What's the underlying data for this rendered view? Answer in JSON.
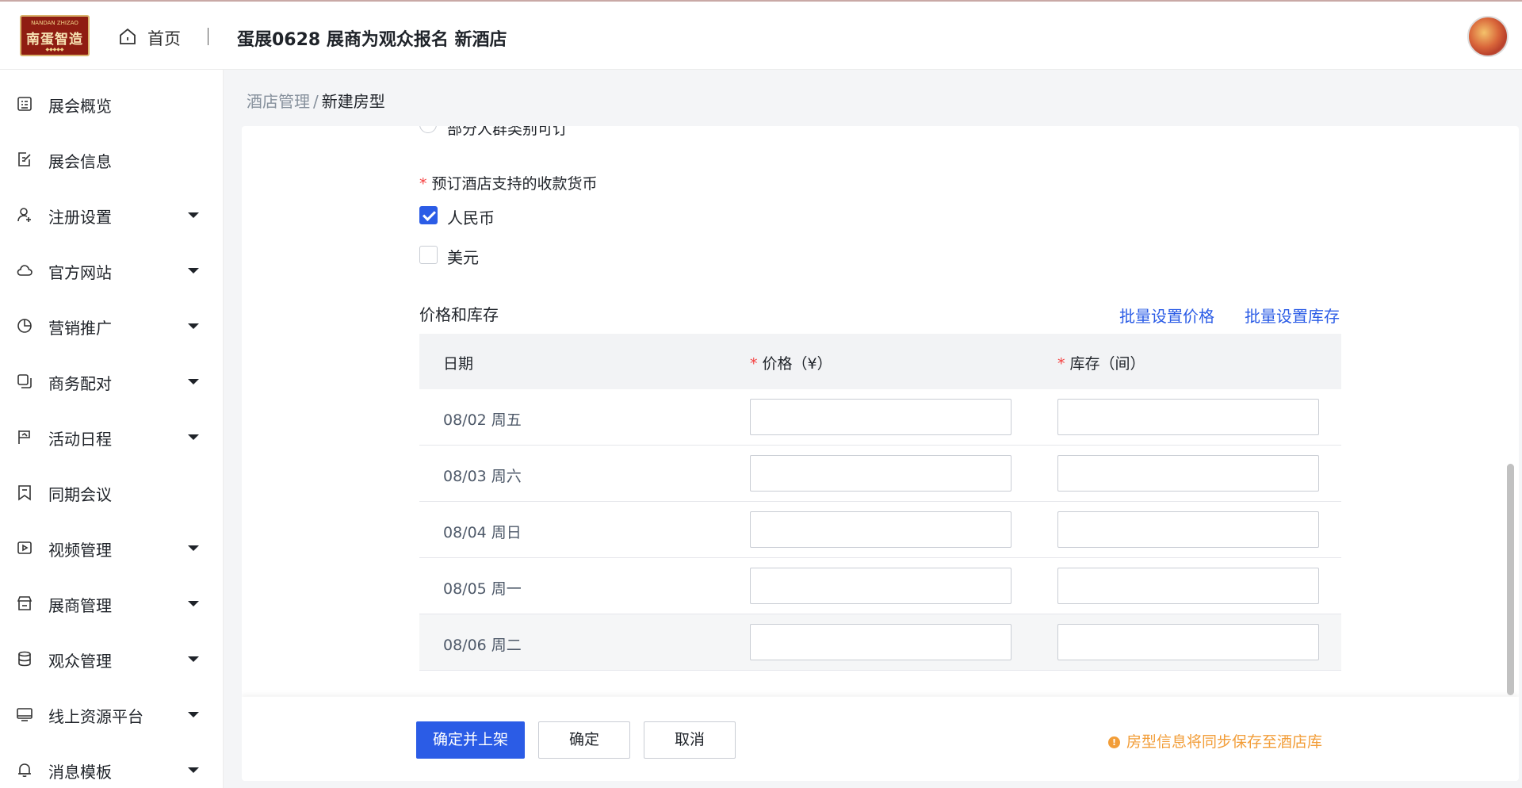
{
  "header": {
    "logo_text": "南蛋智造",
    "logo_sub": "NANDAN ZHIZAO",
    "logo_dots": "◆◆◆◆◆",
    "home_label": "首页",
    "title": "蛋展0628 展商为观众报名 新酒店",
    "home_icon": "home-icon",
    "avatar": "user-avatar"
  },
  "sidebar": {
    "items": [
      {
        "label": "展会概览",
        "icon": "overview-icon",
        "expandable": false
      },
      {
        "label": "展会信息",
        "icon": "edit-doc-icon",
        "expandable": false
      },
      {
        "label": "注册设置",
        "icon": "user-add-icon",
        "expandable": true
      },
      {
        "label": "官方网站",
        "icon": "cloud-icon",
        "expandable": true
      },
      {
        "label": "营销推广",
        "icon": "pie-chart-icon",
        "expandable": true
      },
      {
        "label": "商务配对",
        "icon": "copy-icon",
        "expandable": true
      },
      {
        "label": "活动日程",
        "icon": "flag-icon",
        "expandable": true
      },
      {
        "label": "同期会议",
        "icon": "bookmark-icon",
        "expandable": false
      },
      {
        "label": "视频管理",
        "icon": "video-icon",
        "expandable": true
      },
      {
        "label": "展商管理",
        "icon": "store-icon",
        "expandable": true
      },
      {
        "label": "观众管理",
        "icon": "database-icon",
        "expandable": true
      },
      {
        "label": "线上资源平台",
        "icon": "monitor-icon",
        "expandable": true
      },
      {
        "label": "消息模板",
        "icon": "bell-icon",
        "expandable": true
      }
    ]
  },
  "breadcrumb": {
    "parent": "酒店管理",
    "separator": "/",
    "current": "新建房型"
  },
  "form": {
    "partial_radio_label": "部分人群类别可订",
    "currency_label": "预订酒店支持的收款货币",
    "required_mark": "*",
    "currencies": [
      {
        "label": "人民币",
        "checked": true
      },
      {
        "label": "美元",
        "checked": false
      }
    ]
  },
  "pricing": {
    "section_title": "价格和库存",
    "batch_price_link": "批量设置价格",
    "batch_stock_link": "批量设置库存",
    "columns": {
      "date": "日期",
      "price": "价格（¥）",
      "stock": "库存（间）"
    },
    "rows": [
      {
        "date": "08/02 周五",
        "price": "",
        "stock": ""
      },
      {
        "date": "08/03 周六",
        "price": "",
        "stock": ""
      },
      {
        "date": "08/04 周日",
        "price": "",
        "stock": ""
      },
      {
        "date": "08/05 周一",
        "price": "",
        "stock": ""
      },
      {
        "date": "08/06 周二",
        "price": "",
        "stock": ""
      }
    ]
  },
  "footer": {
    "confirm_publish": "确定并上架",
    "confirm": "确定",
    "cancel": "取消",
    "notice_icon": "!",
    "notice": "房型信息将同步保存至酒店库"
  },
  "colors": {
    "primary": "#2b5ce6",
    "warning": "#f29d38",
    "required": "#f53f3f"
  }
}
